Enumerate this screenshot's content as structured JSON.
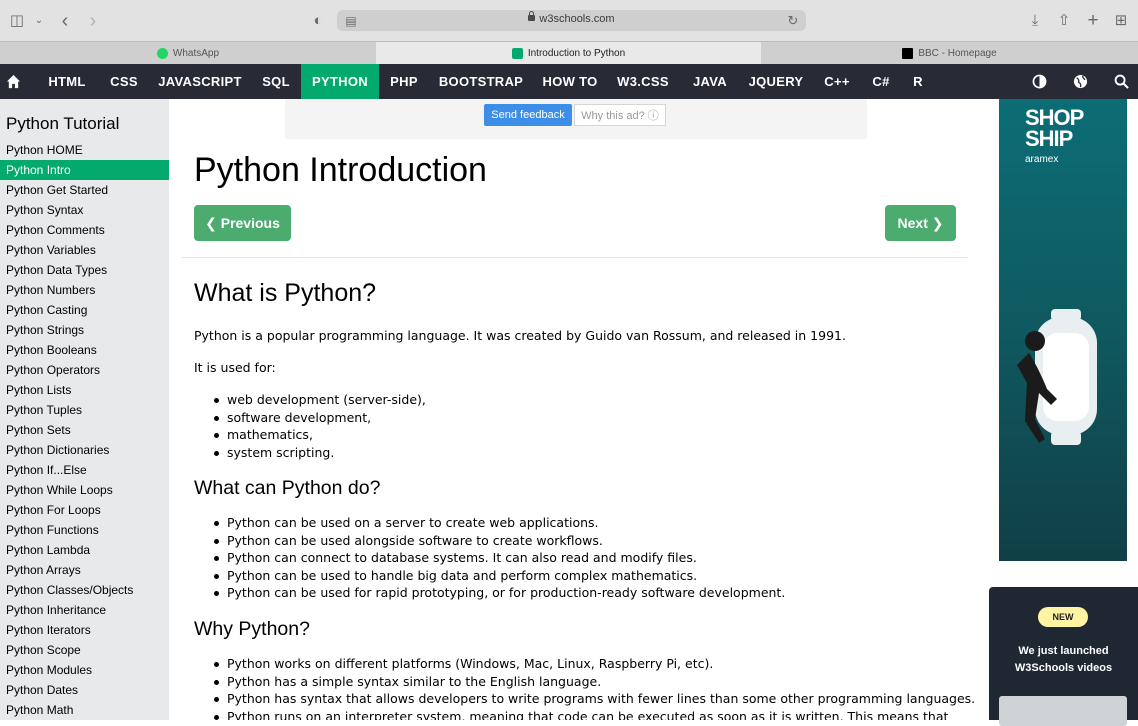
{
  "browser": {
    "url": "w3schools.com",
    "tabs": [
      {
        "title": "WhatsApp",
        "active": false
      },
      {
        "title": "Introduction to Python",
        "active": true
      },
      {
        "title": "BBC - Homepage",
        "active": false
      }
    ]
  },
  "topnav": {
    "items": [
      "HTML",
      "CSS",
      "JAVASCRIPT",
      "SQL",
      "PYTHON",
      "PHP",
      "BOOTSTRAP",
      "HOW TO",
      "W3.CSS",
      "JAVA",
      "JQUERY",
      "C++",
      "C#",
      "R"
    ],
    "active": "PYTHON",
    "accent": "#04aa6d"
  },
  "sidebar": {
    "title": "Python Tutorial",
    "items": [
      "Python HOME",
      "Python Intro",
      "Python Get Started",
      "Python Syntax",
      "Python Comments",
      "Python Variables",
      "Python Data Types",
      "Python Numbers",
      "Python Casting",
      "Python Strings",
      "Python Booleans",
      "Python Operators",
      "Python Lists",
      "Python Tuples",
      "Python Sets",
      "Python Dictionaries",
      "Python If...Else",
      "Python While Loops",
      "Python For Loops",
      "Python Functions",
      "Python Lambda",
      "Python Arrays",
      "Python Classes/Objects",
      "Python Inheritance",
      "Python Iterators",
      "Python Scope",
      "Python Modules",
      "Python Dates",
      "Python Math"
    ],
    "active": "Python Intro"
  },
  "ad_bar": {
    "feedback": "Send feedback",
    "why": "Why this ad? ⓘ"
  },
  "main": {
    "title": "Python Introduction",
    "prev_label": "❮ Previous",
    "next_label": "Next ❯",
    "what_heading": "What is Python?",
    "what_para": "Python is a popular programming language. It was created by Guido van Rossum, and released in 1991.",
    "used_for": "It is used for:",
    "uses": [
      "web development (server-side),",
      "software development,",
      "mathematics,",
      "system scripting."
    ],
    "can_heading": "What can Python do?",
    "can": [
      "Python can be used on a server to create web applications.",
      "Python can be used alongside software to create workflows.",
      "Python can connect to database systems. It can also read and modify files.",
      "Python can be used to handle big data and perform complex mathematics.",
      "Python can be used for rapid prototyping, or for production-ready software development."
    ],
    "why_heading": "Why Python?",
    "why": [
      "Python works on different platforms (Windows, Mac, Linux, Raspberry Pi, etc).",
      "Python has a simple syntax similar to the English language.",
      "Python has syntax that allows developers to write programs with fewer lines than some other programming languages.",
      "Python runs on an interpreter system, meaning that code can be executed as soon as it is written. This means that"
    ]
  },
  "ads": {
    "shop_line1": "SHOP",
    "shop_line2": "SHIP",
    "shop_sub": "aramex",
    "badge": "NEW",
    "launch_line1": "We just launched",
    "launch_line2": "W3Schools videos"
  }
}
